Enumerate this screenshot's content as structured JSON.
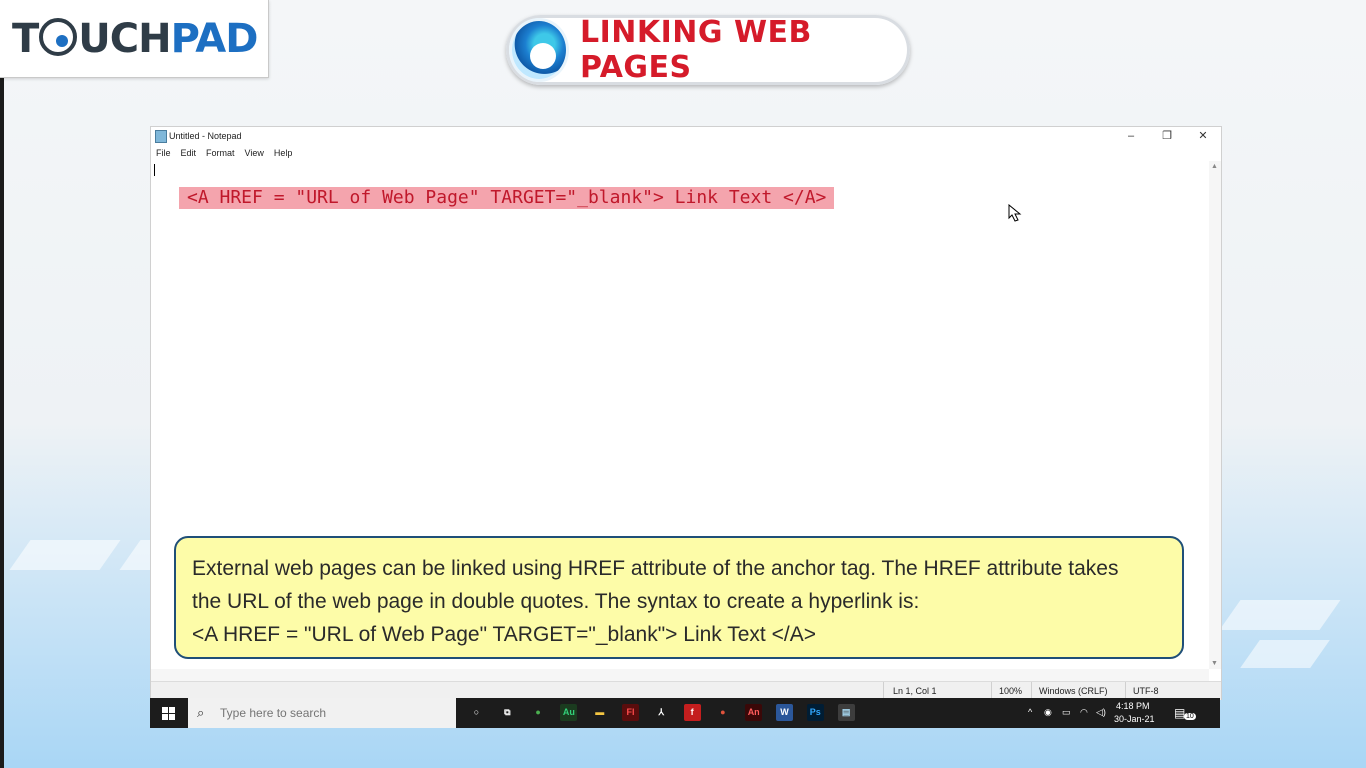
{
  "brand": {
    "logo_left": "T",
    "logo_mid": "UCH",
    "logo_pad": "PAD"
  },
  "banner": {
    "title": "LINKING WEB PAGES",
    "icon": "edge-browser-icon"
  },
  "notepad": {
    "window_title": "Untitled - Notepad",
    "menu": [
      "File",
      "Edit",
      "Format",
      "View",
      "Help"
    ],
    "controls": {
      "minimize": "–",
      "maximize": "❐",
      "close": "✕"
    },
    "content_line": "<A HREF = \"URL of Web Page\" TARGET=\"_blank\"> Link Text </A>",
    "status": {
      "position": "Ln 1, Col 1",
      "zoom": "100%",
      "line_ending": "Windows (CRLF)",
      "encoding": "UTF-8"
    }
  },
  "info": {
    "line1": "External web pages can be linked using HREF attribute of the anchor tag. The HREF attribute takes",
    "line2": "the URL of the web page in double quotes. The syntax to create a hyperlink is:",
    "line3": "<A HREF = \"URL of Web Page\" TARGET=\"_blank\"> Link Text </A>"
  },
  "taskbar": {
    "search_placeholder": "Type here to search",
    "apps": [
      {
        "icon": "cortana-icon",
        "label": "○",
        "color": "#1c1c1c",
        "fg": "#ffffff"
      },
      {
        "icon": "task-view-icon",
        "label": "⧉",
        "color": "#1c1c1c",
        "fg": "#ffffff"
      },
      {
        "icon": "chrome-icon",
        "label": "●",
        "color": "#1c1c1c",
        "fg": "#4caf50"
      },
      {
        "icon": "audition-icon",
        "label": "Au",
        "color": "#1b3b1f",
        "fg": "#33d17a"
      },
      {
        "icon": "file-explorer-icon",
        "label": "▬",
        "color": "#1c1c1c",
        "fg": "#f4c542"
      },
      {
        "icon": "flash-icon",
        "label": "Fl",
        "color": "#5a0d0d",
        "fg": "#ff4d4d"
      },
      {
        "icon": "acrobat-icon",
        "label": "⅄",
        "color": "#1c1c1c",
        "fg": "#ffffff"
      },
      {
        "icon": "flash-player-icon",
        "label": "f",
        "color": "#c41e1e",
        "fg": "#ffffff"
      },
      {
        "icon": "chrome-profile-icon",
        "label": "●",
        "color": "#1c1c1c",
        "fg": "#e0533c"
      },
      {
        "icon": "animate-icon",
        "label": "An",
        "color": "#3a0808",
        "fg": "#ff5c5c"
      },
      {
        "icon": "word-icon",
        "label": "W",
        "color": "#2b579a",
        "fg": "#ffffff"
      },
      {
        "icon": "photoshop-icon",
        "label": "Ps",
        "color": "#001d34",
        "fg": "#31a8ff"
      },
      {
        "icon": "notepad-icon",
        "label": "▤",
        "color": "#3d3d3d",
        "fg": "#a6d7f0"
      }
    ],
    "tray": {
      "time": "4:18 PM",
      "date": "30-Jan-21",
      "notifications": "10"
    }
  }
}
